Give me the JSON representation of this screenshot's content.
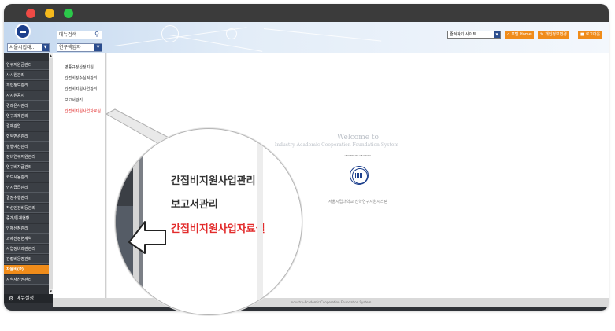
{
  "header": {
    "site_select": "서울시립대...",
    "menu_search": "메뉴검색",
    "menu_select": "연구책임자",
    "shortcut_select": "즐겨찾기 사이트",
    "buttons": [
      "포털 Home",
      "개인정보변경",
      "로그아웃"
    ]
  },
  "leftnav": {
    "items": [
      "연구지원금관리",
      "사시원관리",
      "개인정보관리",
      "사시원공지",
      "경쾌온사관리",
      "연구과제관리",
      "결재관업",
      "협약변경관리",
      "실행예산관리",
      "장비연구지원관리",
      "연구비지급관리",
      "카드사용관리",
      "인지급급관리",
      "결장수행관리",
      "작성인건비등관리",
      "중개/통계현황",
      "인체산정관리",
      "과제산정현계약",
      "사업정비과관관리",
      "간접비운영관리",
      "자율비(P)",
      "지식재산권관리"
    ],
    "active_index": 20,
    "menu_setting": "메뉴설정"
  },
  "submenu": {
    "items": [
      "영종규정산정지원",
      "간접비징수실적관리",
      "간접비지원사업관리",
      "보고서관리",
      "간접비지원사업자료실"
    ],
    "selected_index": 4
  },
  "main": {
    "welcome_line1": "Welcome to",
    "welcome_line2": "Industry-Academic Cooperation Foundation System",
    "university_small": "UNIVERSITY OF SEOUL",
    "system_caption": "서울시립대학교 산학연구지원시스템"
  },
  "footer": {
    "text": "Industry-Academic Cooperation Foundation System"
  },
  "magnifier": {
    "items": [
      "간접비지원사업관리",
      "보고서관리",
      "간접비지원사업자료실"
    ],
    "selected_index": 2
  }
}
